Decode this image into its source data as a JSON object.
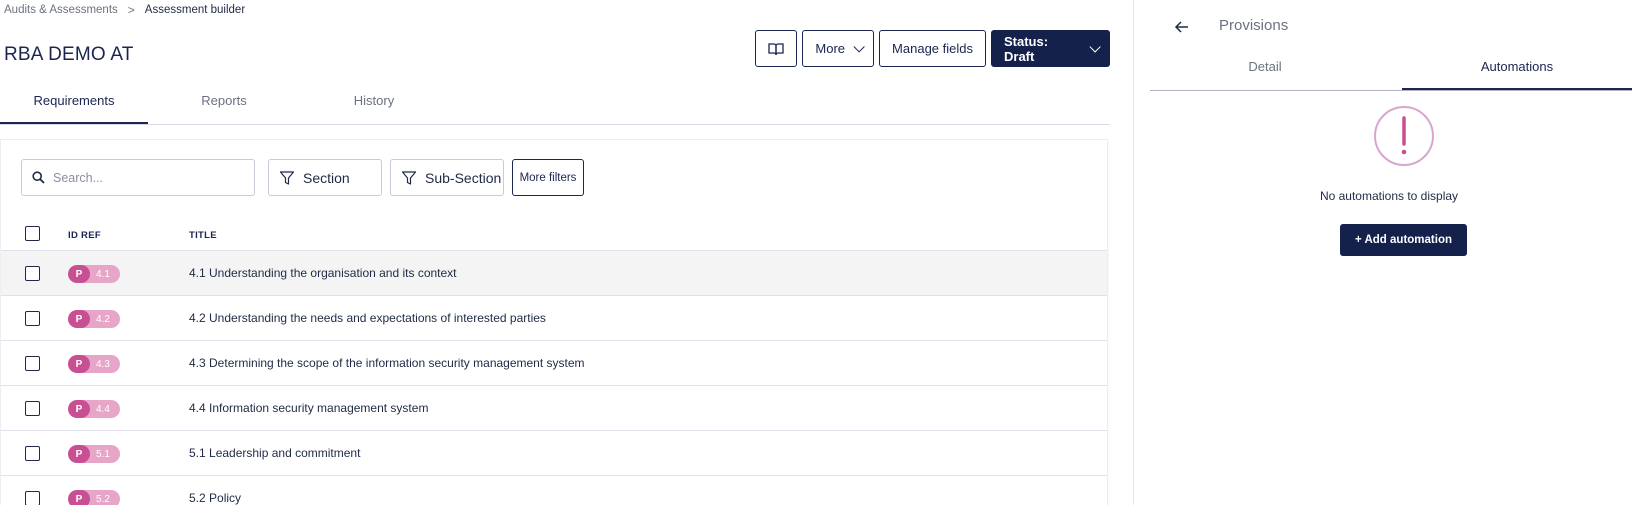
{
  "breadcrumb": {
    "parent": "Audits & Assessments",
    "current": "Assessment builder"
  },
  "page": {
    "title": "RBA DEMO AT"
  },
  "actions": {
    "more_label": "More",
    "manage_fields_label": "Manage fields",
    "status_label": "Status: Draft"
  },
  "tabs": [
    {
      "label": "Requirements",
      "active": true
    },
    {
      "label": "Reports",
      "active": false
    },
    {
      "label": "History",
      "active": false
    }
  ],
  "filters": {
    "search_placeholder": "Search...",
    "section_label": "Section",
    "subsection_label": "Sub-Section",
    "more_filters_label": "More filters"
  },
  "table": {
    "columns": [
      "ID REF",
      "TITLE"
    ],
    "rows": [
      {
        "prefix": "P",
        "id": "4.1",
        "title": "4.1 Understanding the organisation and its context"
      },
      {
        "prefix": "P",
        "id": "4.2",
        "title": "4.2 Understanding the needs and expectations of interested parties"
      },
      {
        "prefix": "P",
        "id": "4.3",
        "title": "4.3 Determining the scope of the information security management system"
      },
      {
        "prefix": "P",
        "id": "4.4",
        "title": "4.4 Information security management system"
      },
      {
        "prefix": "P",
        "id": "5.1",
        "title": "5.1 Leadership and commitment"
      },
      {
        "prefix": "P",
        "id": "5.2",
        "title": "5.2 Policy"
      }
    ]
  },
  "panel": {
    "title": "Provisions",
    "tabs": [
      {
        "label": "Detail",
        "active": false
      },
      {
        "label": "Automations",
        "active": true
      }
    ],
    "empty_text": "No automations to display",
    "add_button_label": "+ Add automation"
  },
  "colors": {
    "primary": "#14224b",
    "badge_dark": "#c84f91",
    "badge_light": "#e7a5c8",
    "alert_icon": "#c874b4"
  }
}
